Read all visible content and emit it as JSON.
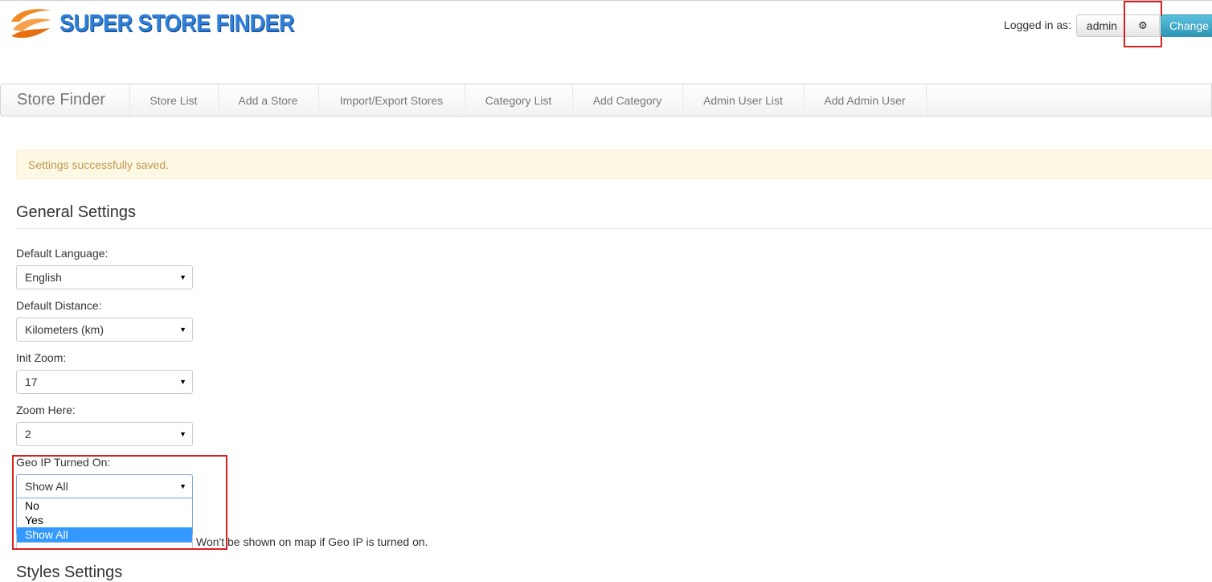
{
  "header": {
    "logo_text": "SUPER STORE FINDER",
    "logged_in_label": "Logged in as:",
    "user_button": "admin",
    "settings_icon": "gear-icon",
    "change_button": "Change"
  },
  "navbar": {
    "brand": "Store Finder",
    "items": [
      {
        "label": "Store List"
      },
      {
        "label": "Add a Store"
      },
      {
        "label": "Import/Export Stores"
      },
      {
        "label": "Category List"
      },
      {
        "label": "Add Category"
      },
      {
        "label": "Admin User List"
      },
      {
        "label": "Add Admin User"
      }
    ]
  },
  "alert": {
    "message": "Settings successfully saved."
  },
  "general_settings": {
    "title": "General Settings",
    "default_language": {
      "label": "Default Language:",
      "value": "English"
    },
    "default_distance": {
      "label": "Default Distance:",
      "value": "Kilometers (km)"
    },
    "init_zoom": {
      "label": "Init Zoom:",
      "value": "17"
    },
    "zoom_here": {
      "label": "Zoom Here:",
      "value": "2"
    },
    "geo_ip": {
      "label": "Geo IP Turned On:",
      "value": "Show All",
      "options": [
        "No",
        "Yes",
        "Show All"
      ],
      "selected_index": 2
    },
    "geo_ip_hint": "Won't be shown on map if Geo IP is turned on."
  },
  "next_section_title": "Styles Settings",
  "colors": {
    "accent": "#2f7fd9",
    "logo_orange": "#f08a24",
    "alert_bg": "#fcf8e3",
    "alert_text": "#c09853",
    "highlight": "#d62121",
    "change_button": "#2f96b4",
    "selected_option": "#3399ff"
  }
}
